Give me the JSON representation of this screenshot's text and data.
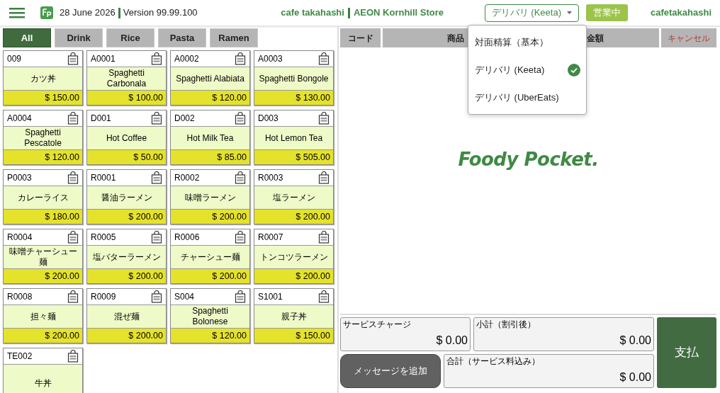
{
  "header": {
    "date": "28 June 2026",
    "version": "Version 99.99.100",
    "store_name": "cafe takahashi",
    "store_location": "AEON Kornhill Store",
    "order_type": "デリバリ (Keeta)",
    "status_badge": "営業中",
    "user": "cafetakahashi"
  },
  "order_type_menu": [
    {
      "label": "対面精算（基本）",
      "selected": false
    },
    {
      "label": "デリバリ (Keeta)",
      "selected": true
    },
    {
      "label": "デリバリ (UberEats)",
      "selected": false
    }
  ],
  "categories": [
    {
      "label": "All",
      "selected": true
    },
    {
      "label": "Drink",
      "selected": false
    },
    {
      "label": "Rice",
      "selected": false
    },
    {
      "label": "Pasta",
      "selected": false
    },
    {
      "label": "Ramen",
      "selected": false
    }
  ],
  "products": [
    {
      "code": "009",
      "name": "カツ丼",
      "price": "$ 150.00"
    },
    {
      "code": "A0001",
      "name": "Spaghetti Carbonala",
      "price": "$ 100.00"
    },
    {
      "code": "A0002",
      "name": "Spaghetti Alabiata",
      "price": "$ 120.00"
    },
    {
      "code": "A0003",
      "name": "Spaghetti Bongole",
      "price": "$ 130.00"
    },
    {
      "code": "A0004",
      "name": "Spaghetti Pescatole",
      "price": "$ 120.00"
    },
    {
      "code": "D001",
      "name": "Hot Coffee",
      "price": "$ 50.00"
    },
    {
      "code": "D002",
      "name": "Hot Milk Tea",
      "price": "$ 85.00"
    },
    {
      "code": "D003",
      "name": "Hot Lemon Tea",
      "price": "$ 505.00"
    },
    {
      "code": "P0003",
      "name": "カレーライス",
      "price": "$ 180.00"
    },
    {
      "code": "R0001",
      "name": "醤油ラーメン",
      "price": "$ 200.00"
    },
    {
      "code": "R0002",
      "name": "味噌ラーメン",
      "price": "$ 200.00"
    },
    {
      "code": "R0003",
      "name": "塩ラーメン",
      "price": "$ 200.00"
    },
    {
      "code": "R0004",
      "name": "味噌チャーシュー麺",
      "price": "$ 200.00"
    },
    {
      "code": "R0005",
      "name": "塩バターラーメン",
      "price": "$ 200.00"
    },
    {
      "code": "R0006",
      "name": "チャーシュー麺",
      "price": "$ 200.00"
    },
    {
      "code": "R0007",
      "name": "トンコツラーメン",
      "price": "$ 200.00"
    },
    {
      "code": "R0008",
      "name": "担々麺",
      "price": "$ 200.00"
    },
    {
      "code": "R0009",
      "name": "混ぜ麺",
      "price": "$ 200.00"
    },
    {
      "code": "S004",
      "name": "Spaghetti Bolonese",
      "price": "$ 120.00"
    },
    {
      "code": "S1001",
      "name": "親子丼",
      "price": "$ 150.00"
    },
    {
      "code": "TE002",
      "name": "牛丼"
    }
  ],
  "order_table": {
    "columns": [
      {
        "label": "コード",
        "kind": "code"
      },
      {
        "label": "商品",
        "kind": "item"
      },
      {
        "label": "金額",
        "kind": "amount"
      },
      {
        "label": "キャンセル",
        "kind": "cancel"
      }
    ]
  },
  "brand_logo": "Foody Pocket.",
  "summary": {
    "service_charge": {
      "label": "サービスチャージ",
      "value": "$ 0.00"
    },
    "subtotal": {
      "label": "小計（割引後）",
      "value": "$ 0.00"
    },
    "total": {
      "label": "合計（サービス料込み）",
      "value": "$ 0.00"
    }
  },
  "message_button": "メッセージを追加",
  "pay_button": "支払"
}
